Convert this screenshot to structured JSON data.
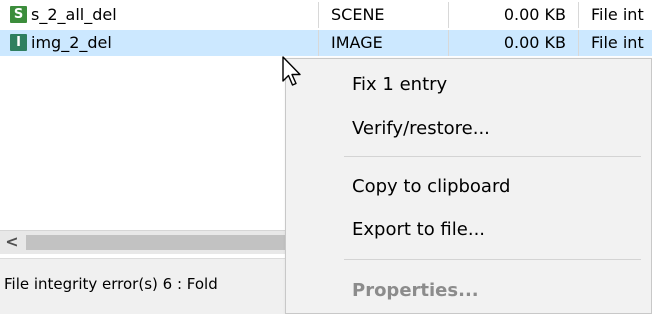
{
  "list": {
    "rows": [
      {
        "badge": "S",
        "name": "s_2_all_del",
        "type": "SCENE",
        "size": "0.00 KB",
        "desc": "File int"
      },
      {
        "badge": "I",
        "name": "img_2_del",
        "type": "IMAGE",
        "size": "0.00 KB",
        "desc": "File int"
      }
    ]
  },
  "scrollbar": {
    "left_arrow": "<"
  },
  "status": {
    "text": "File integrity error(s) 6 : Fold"
  },
  "context_menu": {
    "items": [
      {
        "label": "Fix 1 entry",
        "enabled": true
      },
      {
        "label": "Verify/restore...",
        "enabled": true
      },
      {
        "label": "Copy to clipboard",
        "enabled": true
      },
      {
        "label": "Export to file...",
        "enabled": true
      },
      {
        "label": "Properties...",
        "enabled": false
      }
    ]
  },
  "colors": {
    "selection": "#cce8ff",
    "badge_scene": "#3c8d3c",
    "badge_image": "#2f7f5f",
    "menu_bg": "#f2f2f2",
    "disabled_text": "#8c8c8c"
  },
  "icons": {
    "cursor": "mouse-pointer-icon"
  }
}
